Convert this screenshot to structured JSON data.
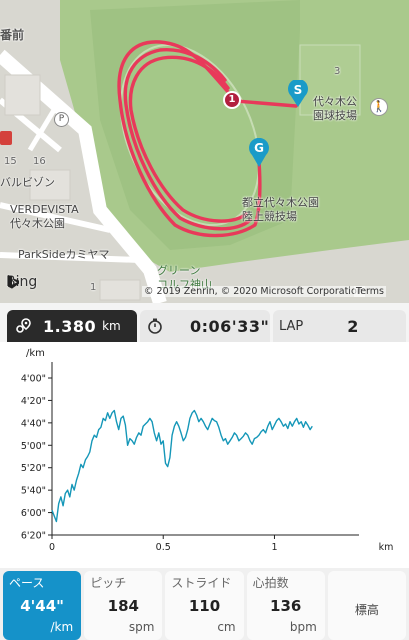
{
  "map": {
    "labels": {
      "area_top_left": "番前",
      "park_ball": "代々木公\n園球技場",
      "park_land": "都立代々木公園\n陸上競技場",
      "vardi": "バルビゾン",
      "verdevista": "VERDEVISTA\n代々木公園",
      "parkside": "ParkSideカミヤマ",
      "green": "グリーン\nコルフ神山",
      "num15": "15",
      "num16": "16",
      "num3": "3",
      "num1": "1",
      "marker_p": "P"
    },
    "markers": {
      "start": "S",
      "goal": "G",
      "lap": "1"
    },
    "bing_label": "Bing",
    "copyright": "© 2019 Zenrin, © 2020 Microsoft Corporation",
    "terms": "Terms",
    "route_color": "#e8395a"
  },
  "stats": {
    "distance_value": "1.380",
    "distance_unit": "km",
    "time_value": "0:06'33\"",
    "lap_label": "LAP",
    "lap_value": "2"
  },
  "chart_data": {
    "type": "line",
    "ylabel": "/km",
    "xlabel": "km",
    "x_ticks": [
      "0",
      "0.5",
      "1"
    ],
    "x_tick_values": [
      0,
      0.5,
      1
    ],
    "y_ticks": [
      "4'00\"",
      "4'20\"",
      "4'40\"",
      "5'00\"",
      "5'20\"",
      "5'40\"",
      "6'00\"",
      "6'20\""
    ],
    "y_tick_seconds": [
      240,
      260,
      280,
      300,
      320,
      340,
      360,
      380
    ],
    "xlim": [
      0,
      1.38
    ],
    "ylim_seconds": [
      240,
      380
    ],
    "y_inverted": true,
    "series": [
      {
        "color": "#1597b8",
        "x": [
          0,
          0.01,
          0.02,
          0.03,
          0.04,
          0.05,
          0.06,
          0.07,
          0.08,
          0.09,
          0.1,
          0.11,
          0.12,
          0.13,
          0.14,
          0.15,
          0.16,
          0.17,
          0.18,
          0.19,
          0.2,
          0.21,
          0.22,
          0.23,
          0.24,
          0.25,
          0.26,
          0.27,
          0.28,
          0.29,
          0.3,
          0.31,
          0.32,
          0.33,
          0.34,
          0.35,
          0.36,
          0.37,
          0.38,
          0.39,
          0.4,
          0.41,
          0.42,
          0.43,
          0.44,
          0.45,
          0.46,
          0.47,
          0.48,
          0.49,
          0.5,
          0.51,
          0.52,
          0.53,
          0.54,
          0.55,
          0.56,
          0.57,
          0.58,
          0.59,
          0.6,
          0.61,
          0.62,
          0.63,
          0.64,
          0.65,
          0.66,
          0.67,
          0.68,
          0.69,
          0.7,
          0.71,
          0.72,
          0.73,
          0.74,
          0.75,
          0.76,
          0.77,
          0.78,
          0.79,
          0.8,
          0.81,
          0.82,
          0.83,
          0.84,
          0.85,
          0.86,
          0.87,
          0.88,
          0.89,
          0.9,
          0.91,
          0.92,
          0.93,
          0.94,
          0.95,
          0.96,
          0.97,
          0.98,
          0.99,
          1.0,
          1.01,
          1.02,
          1.03,
          1.04,
          1.05,
          1.06,
          1.07,
          1.08,
          1.09,
          1.1,
          1.11,
          1.12,
          1.13,
          1.14,
          1.15,
          1.16,
          1.17,
          1.18,
          1.19,
          1.2,
          1.21,
          1.22,
          1.23,
          1.24,
          1.25,
          1.26,
          1.27,
          1.28,
          1.29,
          1.3,
          1.31,
          1.32,
          1.33,
          1.34,
          1.35,
          1.36,
          1.37,
          1.38
        ],
        "y_seconds": [
          358,
          363,
          368,
          352,
          346,
          354,
          343,
          340,
          346,
          335,
          340,
          331,
          325,
          317,
          320,
          313,
          310,
          306,
          296,
          291,
          293,
          286,
          284,
          276,
          278,
          271,
          276,
          271,
          269,
          279,
          286,
          276,
          274,
          282,
          300,
          294,
          296,
          299,
          293,
          289,
          291,
          283,
          281,
          279,
          276,
          279,
          289,
          296,
          289,
          299,
          296,
          316,
          319,
          311,
          291,
          283,
          279,
          283,
          289,
          296,
          293,
          286,
          276,
          271,
          269,
          273,
          279,
          276,
          279,
          283,
          286,
          281,
          276,
          278,
          279,
          284,
          291,
          296,
          294,
          299,
          296,
          293,
          289,
          291,
          296,
          294,
          292,
          289,
          291,
          296,
          299,
          294,
          293,
          291,
          288,
          286,
          289,
          283,
          279,
          286,
          282,
          278,
          276,
          279,
          283,
          281,
          285,
          279,
          283,
          279,
          276,
          281,
          279,
          284,
          279,
          282,
          286,
          283
        ]
      }
    ]
  },
  "tabs": [
    {
      "label": "ペース",
      "value": "4'44\"",
      "unit": "/km",
      "active": true
    },
    {
      "label": "ピッチ",
      "value": "184",
      "unit": "spm",
      "active": false
    },
    {
      "label": "ストライド",
      "value": "110",
      "unit": "cm",
      "active": false
    },
    {
      "label": "心拍数",
      "value": "136",
      "unit": "bpm",
      "active": false
    },
    {
      "label": "",
      "value": "標高",
      "unit": "",
      "active": false
    }
  ]
}
